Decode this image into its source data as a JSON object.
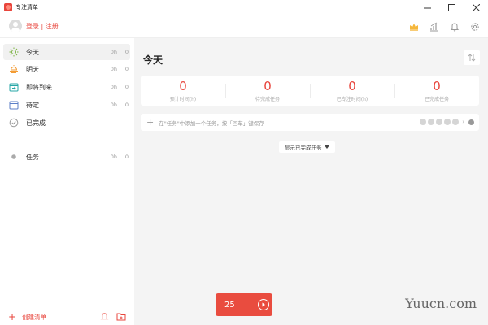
{
  "window": {
    "title": "专注清单",
    "controls": [
      "minimize",
      "maximize",
      "close"
    ]
  },
  "header": {
    "login_label": "登录 | 注册",
    "icons": [
      "crown-icon",
      "chart-icon",
      "bell-icon",
      "settings-icon"
    ],
    "accent_color": "#e8453c",
    "crown_color": "#f5b73b"
  },
  "sidebar": {
    "items": [
      {
        "label": "今天",
        "time": "0h",
        "count": "0",
        "icon": "sun-icon",
        "active": true
      },
      {
        "label": "明天",
        "time": "0h",
        "count": "0",
        "icon": "sunset-icon",
        "active": false
      },
      {
        "label": "即将到来",
        "time": "0h",
        "count": "0",
        "icon": "calendar-upcoming-icon",
        "active": false
      },
      {
        "label": "待定",
        "time": "0h",
        "count": "0",
        "icon": "calendar-pending-icon",
        "active": false
      },
      {
        "label": "已完成",
        "time": "",
        "count": "",
        "icon": "check-circle-icon",
        "active": false
      }
    ],
    "lists": [
      {
        "label": "任务",
        "time": "0h",
        "count": "0",
        "icon": "dot-icon"
      }
    ],
    "create_list_label": "创建清单"
  },
  "main": {
    "title": "今天",
    "stats": [
      {
        "value": "0",
        "label": "预计时间(h)"
      },
      {
        "value": "0",
        "label": "待完成任务"
      },
      {
        "value": "0",
        "label": "已专注时间(h)"
      },
      {
        "value": "0",
        "label": "已完成任务"
      }
    ],
    "add_task_placeholder": "在\"任务\"中添加一个任务，按「回车」键保存",
    "pomodoro_count": 5,
    "show_completed_label": "显示已完成任务"
  },
  "timer": {
    "minutes": "25",
    "color": "#e94c3f"
  },
  "watermark": "Yuucn.com"
}
